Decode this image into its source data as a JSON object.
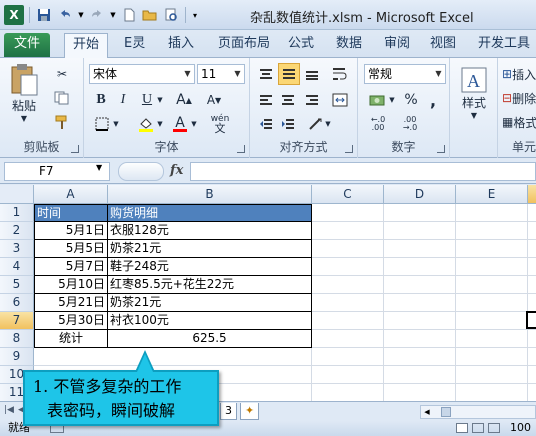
{
  "window": {
    "title": "杂乱数值统计.xlsm - Microsoft Excel",
    "logo_letter": "X"
  },
  "tabs": [
    "文件",
    "开始",
    "E灵",
    "插入",
    "页面布局",
    "公式",
    "数据",
    "审阅",
    "视图",
    "开发工具"
  ],
  "ribbon": {
    "clipboard": {
      "paste": "粘贴",
      "label": "剪贴板"
    },
    "font": {
      "name": "宋体",
      "size": "11",
      "bold": "B",
      "italic": "I",
      "underline": "U",
      "font_color_letter": "A",
      "wen": "wén",
      "label": "字体"
    },
    "alignment": {
      "label": "对齐方式"
    },
    "number": {
      "format": "常规",
      "percent": "%",
      "comma": ",",
      "label": "数字"
    },
    "styles": {
      "label": "样式"
    },
    "cells": {
      "insert": "插入",
      "delete": "删除",
      "format": "格式",
      "label": "单元"
    }
  },
  "formula_bar": {
    "name_box": "F7",
    "fx": "fx",
    "content": ""
  },
  "sheet": {
    "columns": [
      "A",
      "B",
      "C",
      "D",
      "E"
    ],
    "rows": [
      "1",
      "2",
      "3",
      "4",
      "5",
      "6",
      "7",
      "8",
      "9",
      "10",
      "11"
    ],
    "selected_column": "F",
    "selected_row": "7",
    "cells": {
      "A1": "时间",
      "B1": "购货明细",
      "A2": "5月1日",
      "B2": "衣服128元",
      "A3": "5月5日",
      "B3": "奶茶21元",
      "A4": "5月7日",
      "B4": "鞋子248元",
      "A5": "5月10日",
      "B5": "红枣85.5元+花生22元",
      "A6": "5月21日",
      "B6": "奶茶21元",
      "A7": "5月30日",
      "B7": "衬衣100元",
      "A8": "统计",
      "B8": "625.5"
    },
    "visible_tab_label": "3"
  },
  "status": {
    "ready": "就绪",
    "zoom": "100"
  },
  "callout": {
    "line1": "1. 不管多复杂的工作",
    "line2": "表密码，瞬间破解"
  },
  "colors": {
    "header_fill": "#4f81bd",
    "file_tab": "#1e7145",
    "callout": "#1ec5e8"
  }
}
